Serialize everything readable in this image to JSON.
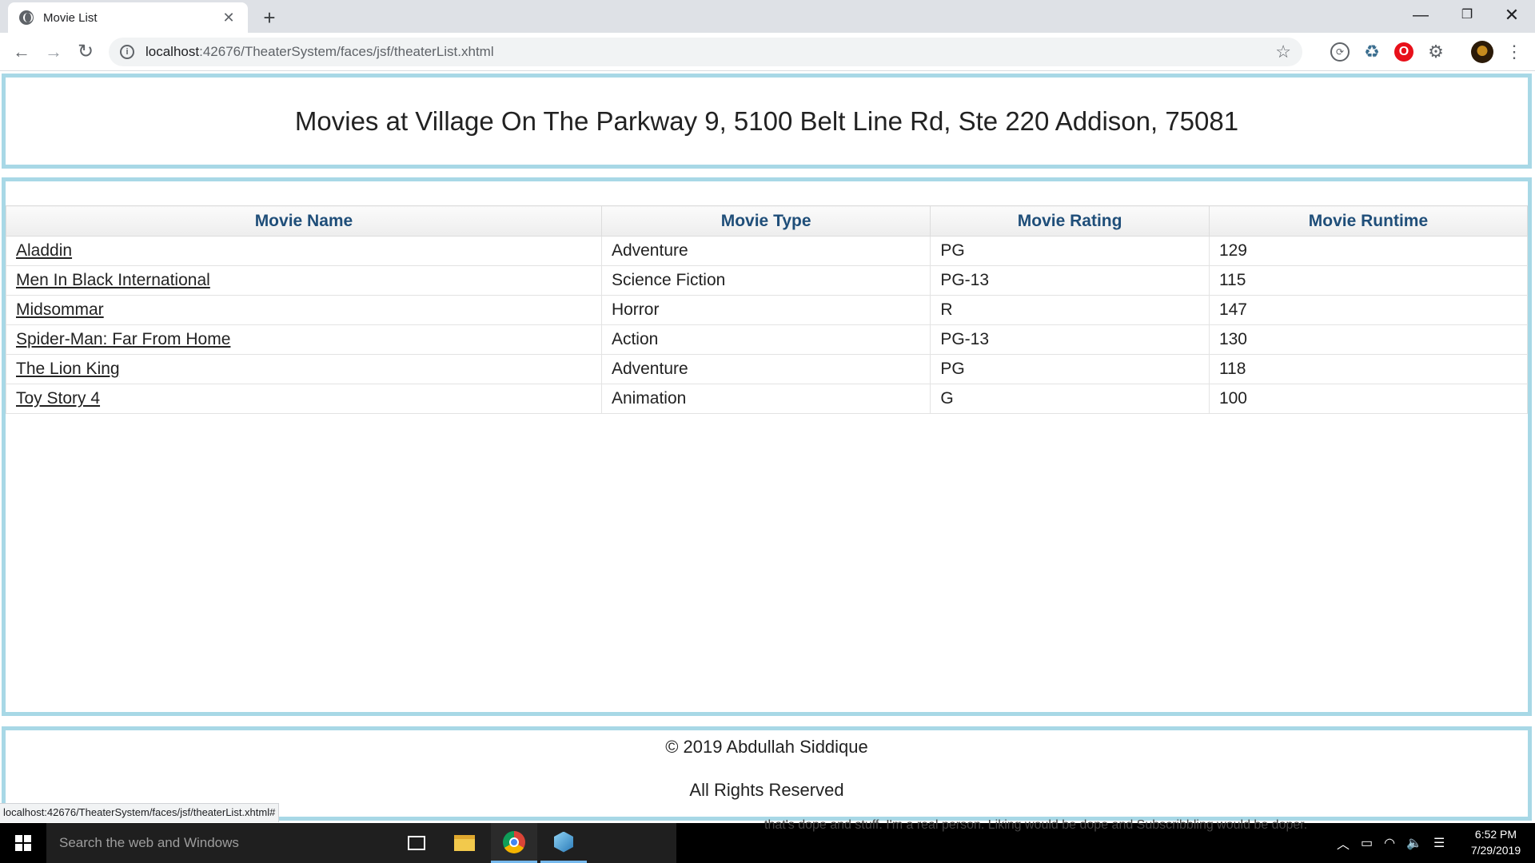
{
  "browser": {
    "tab_title": "Movie List",
    "tab_close": "✕",
    "new_tab": "+",
    "url_host": "localhost",
    "url_path": ":42676/TheaterSystem/faces/jsf/theaterList.xhtml",
    "window_controls": {
      "minimize": "—",
      "maximize": "❐",
      "close": "✕"
    },
    "nav": {
      "back": "←",
      "forward": "→",
      "reload": "↻"
    },
    "extensions": [
      "sync-icon",
      "recycle-icon",
      "opera-icon",
      "gear-icon"
    ],
    "menu": "⋮"
  },
  "page": {
    "heading": "Movies at Village On The Parkway 9, 5100 Belt Line Rd, Ste 220 Addison, 75081",
    "table": {
      "headers": [
        "Movie Name",
        "Movie Type",
        "Movie Rating",
        "Movie Runtime"
      ],
      "rows": [
        [
          "Aladdin",
          "Adventure",
          "PG",
          "129"
        ],
        [
          "Men In Black International",
          "Science Fiction",
          "PG-13",
          "115"
        ],
        [
          "Midsommar",
          "Horror",
          "R",
          "147"
        ],
        [
          "Spider-Man: Far From Home",
          "Action",
          "PG-13",
          "130"
        ],
        [
          "The Lion King",
          "Adventure",
          "PG",
          "118"
        ],
        [
          "Toy Story 4",
          "Animation",
          "G",
          "100"
        ]
      ]
    },
    "footer": {
      "copyright": "© 2019 Abdullah Siddique",
      "rights": "All Rights Reserved"
    },
    "status_url": "localhost:42676/TheaterSystem/faces/jsf/theaterList.xhtml#",
    "overlay_text": "that's dope and stuff. I'm a real person. Liking would be dope and Subscribbling would be doper."
  },
  "taskbar": {
    "search_placeholder": "Search the web and Windows",
    "time": "6:52 PM",
    "date": "7/29/2019"
  },
  "colors": {
    "panel_border": "#a8d8e6",
    "header_text": "#1f4e79",
    "taskbar": "#000000"
  }
}
